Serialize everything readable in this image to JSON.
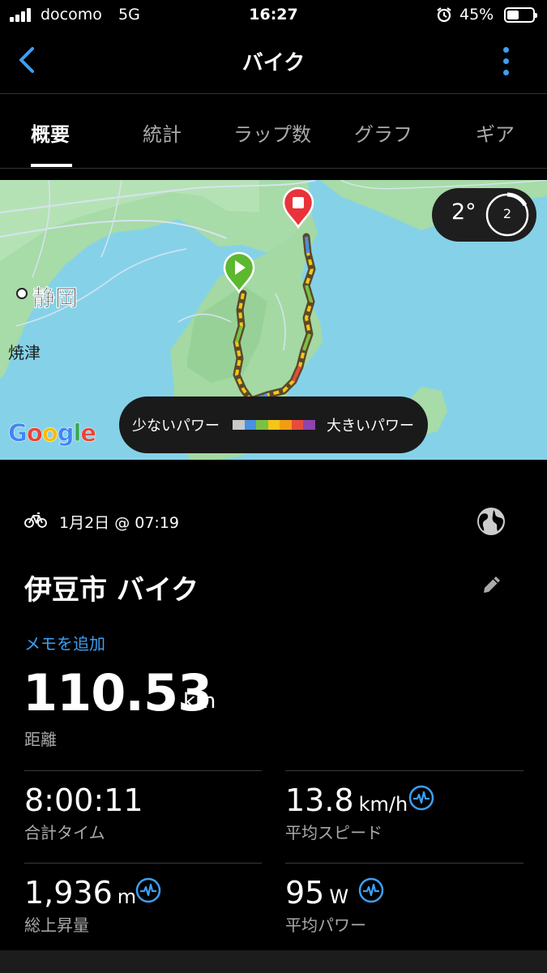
{
  "status_bar": {
    "carrier": "docomo",
    "network": "5G",
    "time": "16:27",
    "battery": "45%",
    "battery_level": 0.45,
    "icons": [
      "signal-icon",
      "alarm-icon",
      "battery-icon"
    ]
  },
  "header": {
    "title": "バイク",
    "icons": [
      "back-chevron-icon",
      "more-vertical-icon"
    ],
    "accent_color": "#3d9ff5"
  },
  "tabs": [
    {
      "label": "概要",
      "active": true
    },
    {
      "label": "統計",
      "active": false
    },
    {
      "label": "ラップ数",
      "active": false
    },
    {
      "label": "グラフ",
      "active": false
    },
    {
      "label": "ギア",
      "active": false
    }
  ],
  "map": {
    "places": [
      "静岡",
      "焼津"
    ],
    "attribution": "Google",
    "weather": {
      "temperature": "2°",
      "wind": "2"
    },
    "legend": {
      "low_label": "少ないパワー",
      "high_label": "大きいパワー",
      "colors": [
        "#c8c8c8",
        "#4a90e2",
        "#7ac143",
        "#f5c518",
        "#f39c12",
        "#e74c3c",
        "#8e44ad"
      ]
    },
    "markers": [
      "start-marker",
      "finish-marker"
    ]
  },
  "activity": {
    "date": "1月2日 @ 07:19",
    "name": "伊豆市 バイク",
    "memo_link": "メモを追加",
    "distance": {
      "value": "110.53",
      "unit": "km",
      "label": "距離"
    },
    "stats": [
      {
        "value": "8:00:11",
        "unit": "",
        "label": "合計タイム",
        "power_icon": false
      },
      {
        "value": "13.8",
        "unit": "km/h",
        "label": "平均スピード",
        "power_icon": true
      },
      {
        "value": "1,936",
        "unit": "m",
        "label": "総上昇量",
        "power_icon": true
      },
      {
        "value": "95",
        "unit": "W",
        "label": "平均パワー",
        "power_icon": true
      }
    ]
  }
}
